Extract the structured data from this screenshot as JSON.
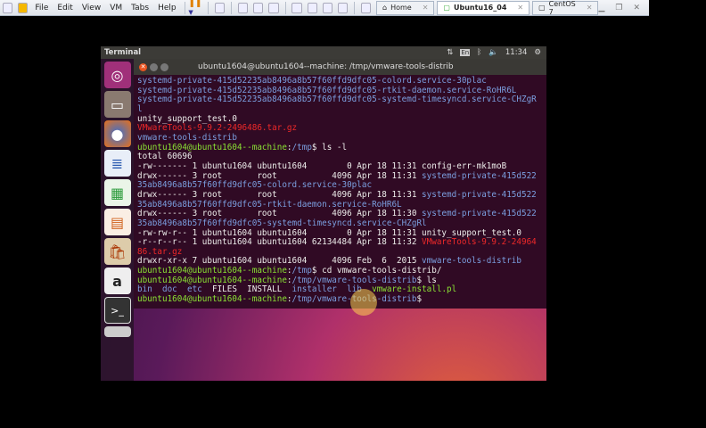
{
  "vmware": {
    "menu": [
      "File",
      "Edit",
      "View",
      "VM",
      "Tabs",
      "Help"
    ],
    "tabs": [
      {
        "label": "Home"
      },
      {
        "label": "Ubuntu16_04",
        "active": true
      },
      {
        "label": "CentOS 7"
      }
    ]
  },
  "panel": {
    "app": "Terminal",
    "lang": "En",
    "time": "11:34"
  },
  "terminal": {
    "title": "ubuntu1604@ubuntu1604--machine: /tmp/vmware-tools-distrib",
    "lines": [
      [
        {
          "t": "systemd-private-415d52235ab8496a8b57f60ffd9dfc05-colord.service-30plac",
          "c": "#7b9fe0"
        }
      ],
      [
        {
          "t": "systemd-private-415d52235ab8496a8b57f60ffd9dfc05-rtkit-daemon.service-RoHR6L",
          "c": "#7b9fe0"
        }
      ],
      [
        {
          "t": "systemd-private-415d52235ab8496a8b57f60ffd9dfc05-systemd-timesyncd.service-CHZgR",
          "c": "#7b9fe0"
        }
      ],
      [
        {
          "t": "l",
          "c": "#7b9fe0"
        }
      ],
      [
        {
          "t": "unity_support_test.0",
          "c": "#eeeeec"
        }
      ],
      [
        {
          "t": "VMwareTools-9.9.2-2496486.tar.gz",
          "c": "#ef2929"
        }
      ],
      [
        {
          "t": "vmware-tools-distrib",
          "c": "#7b9fe0"
        }
      ],
      [
        {
          "t": "ubuntu1604@ubuntu1604--machine",
          "c": "#8ae234"
        },
        {
          "t": ":",
          "c": "#eeeeec"
        },
        {
          "t": "/tmp",
          "c": "#7b9fe0"
        },
        {
          "t": "$ ls -l",
          "c": "#eeeeec"
        }
      ],
      [
        {
          "t": "total 60696",
          "c": "#eeeeec"
        }
      ],
      [
        {
          "t": "-rw------- 1 ubuntu1604 ubuntu1604        0 Apr 18 11:31 config-err-mk1moB",
          "c": "#eeeeec"
        }
      ],
      [
        {
          "t": "drwx------ 3 root       root           4096 Apr 18 11:31 ",
          "c": "#eeeeec"
        },
        {
          "t": "systemd-private-415d522",
          "c": "#7b9fe0"
        }
      ],
      [
        {
          "t": "35ab8496a8b57f60ffd9dfc05-colord.service-30plac",
          "c": "#7b9fe0"
        }
      ],
      [
        {
          "t": "drwx------ 3 root       root           4096 Apr 18 11:31 ",
          "c": "#eeeeec"
        },
        {
          "t": "systemd-private-415d522",
          "c": "#7b9fe0"
        }
      ],
      [
        {
          "t": "35ab8496a8b57f60ffd9dfc05-rtkit-daemon.service-RoHR6L",
          "c": "#7b9fe0"
        }
      ],
      [
        {
          "t": "drwx------ 3 root       root           4096 Apr 18 11:30 ",
          "c": "#eeeeec"
        },
        {
          "t": "systemd-private-415d522",
          "c": "#7b9fe0"
        }
      ],
      [
        {
          "t": "35ab8496a8b57f60ffd9dfc05-systemd-timesyncd.service-CHZgRl",
          "c": "#7b9fe0"
        }
      ],
      [
        {
          "t": "-rw-rw-r-- 1 ubuntu1604 ubuntu1604        0 Apr 18 11:31 unity_support_test.0",
          "c": "#eeeeec"
        }
      ],
      [
        {
          "t": "-r--r--r-- 1 ubuntu1604 ubuntu1604 62134484 Apr 18 11:32 ",
          "c": "#eeeeec"
        },
        {
          "t": "VMwareTools-9.9.2-24964",
          "c": "#ef2929"
        }
      ],
      [
        {
          "t": "86.tar.gz",
          "c": "#ef2929"
        }
      ],
      [
        {
          "t": "drwxr-xr-x 7 ubuntu1604 ubuntu1604     4096 Feb  6  2015 ",
          "c": "#eeeeec"
        },
        {
          "t": "vmware-tools-distrib",
          "c": "#7b9fe0"
        }
      ],
      [
        {
          "t": "ubuntu1604@ubuntu1604--machine",
          "c": "#8ae234"
        },
        {
          "t": ":",
          "c": "#eeeeec"
        },
        {
          "t": "/tmp",
          "c": "#7b9fe0"
        },
        {
          "t": "$ cd vmware-tools-distrib/",
          "c": "#eeeeec"
        }
      ],
      [
        {
          "t": "ubuntu1604@ubuntu1604--machine",
          "c": "#8ae234"
        },
        {
          "t": ":",
          "c": "#eeeeec"
        },
        {
          "t": "/tmp/vmware-tools-distrib",
          "c": "#7b9fe0"
        },
        {
          "t": "$ ls",
          "c": "#eeeeec"
        }
      ],
      [
        {
          "t": "bin  doc  etc  ",
          "c": "#7b9fe0"
        },
        {
          "t": "FILES  INSTALL  ",
          "c": "#eeeeec"
        },
        {
          "t": "installer  lib  ",
          "c": "#7b9fe0"
        },
        {
          "t": "vmware-install.pl",
          "c": "#8ae234"
        }
      ],
      [
        {
          "t": "ubuntu1604@ubuntu1604--machine",
          "c": "#8ae234"
        },
        {
          "t": ":",
          "c": "#eeeeec"
        },
        {
          "t": "/tmp/vmware-tools-distrib",
          "c": "#7b9fe0"
        },
        {
          "t": "$",
          "c": "#eeeeec"
        }
      ]
    ]
  }
}
